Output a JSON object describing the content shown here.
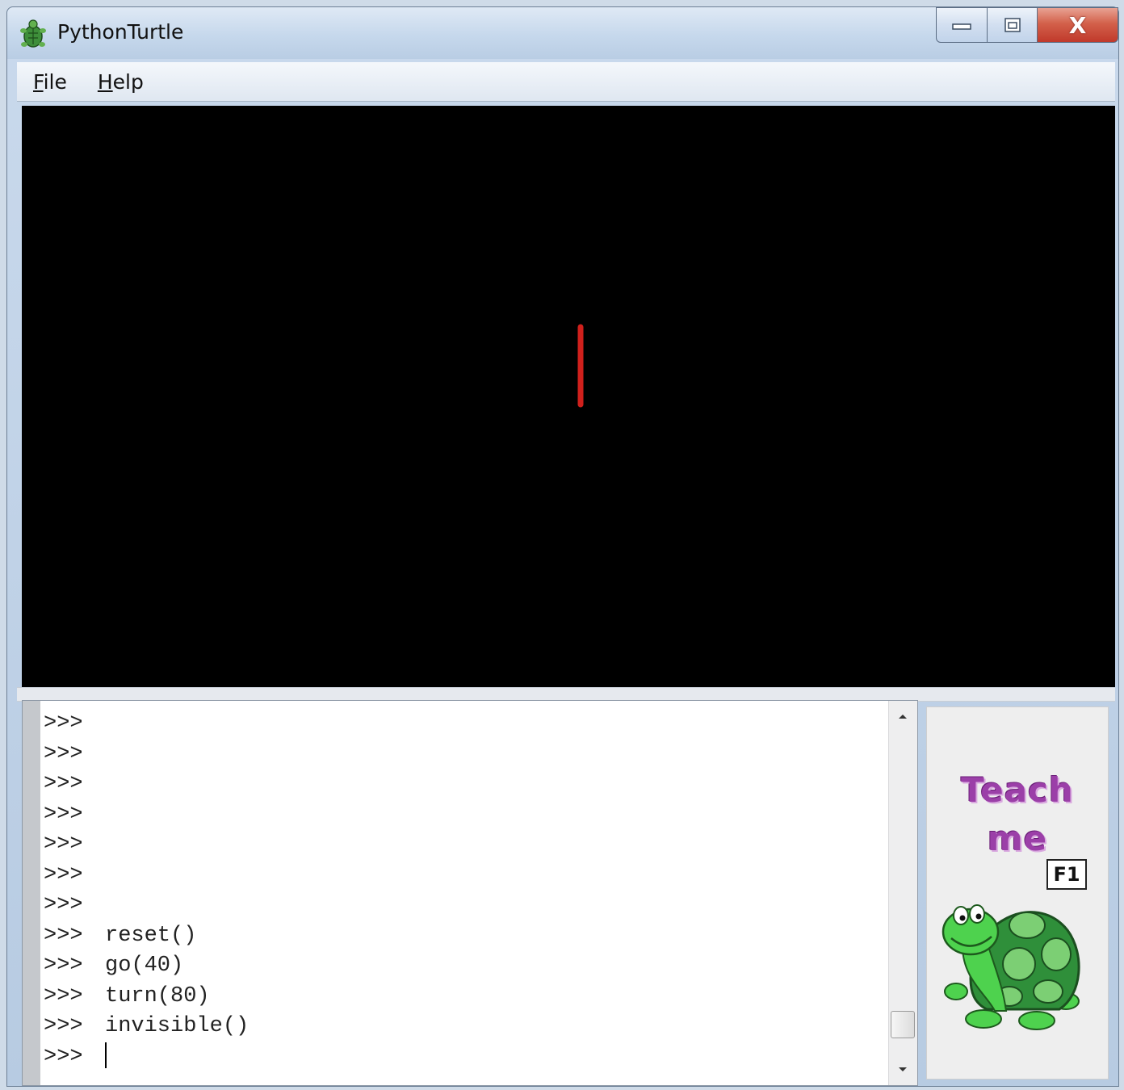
{
  "window": {
    "title": "PythonTurtle",
    "controls": {
      "close_glyph": "X"
    }
  },
  "menu": {
    "items": [
      {
        "mnemonic": "F",
        "rest": "ile"
      },
      {
        "mnemonic": "H",
        "rest": "elp"
      }
    ]
  },
  "canvas": {
    "background": "#000000",
    "pen_color": "#d0201c"
  },
  "shell": {
    "lines": [
      {
        "prompt": ">>>",
        "command": ""
      },
      {
        "prompt": ">>>",
        "command": ""
      },
      {
        "prompt": ">>>",
        "command": ""
      },
      {
        "prompt": ">>>",
        "command": ""
      },
      {
        "prompt": ">>>",
        "command": ""
      },
      {
        "prompt": ">>>",
        "command": ""
      },
      {
        "prompt": ">>>",
        "command": ""
      },
      {
        "prompt": ">>>",
        "command": "reset()"
      },
      {
        "prompt": ">>>",
        "command": "go(40)"
      },
      {
        "prompt": ">>>",
        "command": "turn(80)"
      },
      {
        "prompt": ">>>",
        "command": "invisible()"
      },
      {
        "prompt": ">>>",
        "command": ""
      }
    ]
  },
  "teach": {
    "word1": "Teach",
    "word2": "me",
    "key": "F1",
    "icon": "turtle-icon"
  },
  "colors": {
    "teach_text": "#9b3fa8",
    "turtle_green": "#3fbf3f"
  }
}
